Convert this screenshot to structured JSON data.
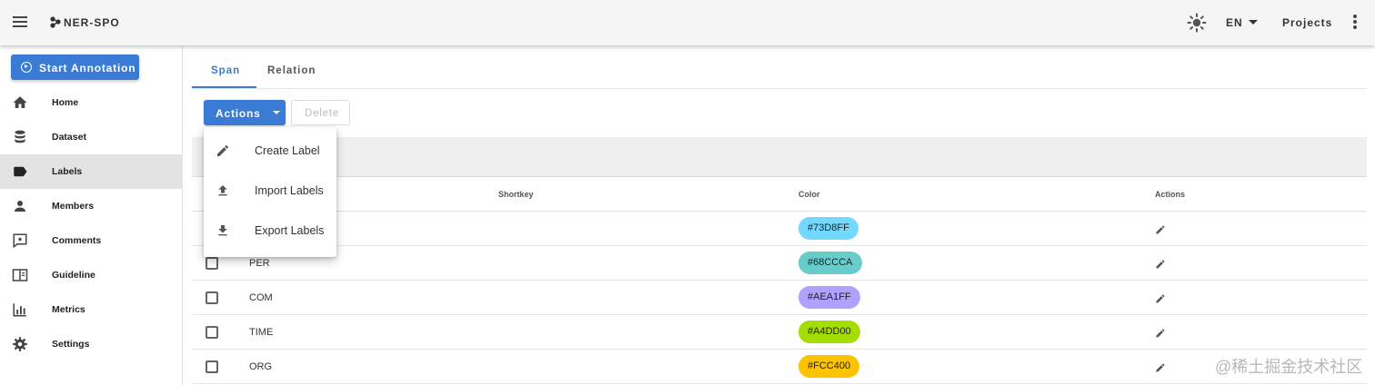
{
  "appbar": {
    "title": "NER-SPO",
    "language": "EN",
    "projects_label": "Projects",
    "icons": [
      "menu-icon",
      "logo-icon",
      "theme-icon",
      "caret-down-icon",
      "more-vert-icon"
    ]
  },
  "sidebar": {
    "start_annotation": "Start Annotation",
    "items": [
      {
        "label": "Home",
        "icon": "home-icon"
      },
      {
        "label": "Dataset",
        "icon": "database-icon"
      },
      {
        "label": "Labels",
        "icon": "label-icon",
        "active": true
      },
      {
        "label": "Members",
        "icon": "person-icon"
      },
      {
        "label": "Comments",
        "icon": "comment-icon"
      },
      {
        "label": "Guideline",
        "icon": "book-icon"
      },
      {
        "label": "Metrics",
        "icon": "chart-icon"
      },
      {
        "label": "Settings",
        "icon": "gear-icon"
      }
    ]
  },
  "tabs": [
    {
      "label": "Span",
      "active": true
    },
    {
      "label": "Relation",
      "active": false
    }
  ],
  "toolbar": {
    "actions_label": "Actions",
    "delete_label": "Delete"
  },
  "actions_menu": [
    {
      "label": "Create Label",
      "icon": "pencil-icon"
    },
    {
      "label": "Import Labels",
      "icon": "upload-icon"
    },
    {
      "label": "Export Labels",
      "icon": "download-icon"
    }
  ],
  "table": {
    "headers": {
      "shortkey": "Shortkey",
      "color": "Color",
      "actions": "Actions"
    },
    "rows": [
      {
        "name": "",
        "color_text": "#73D8FF",
        "color": "#73D8FF"
      },
      {
        "name": "PER",
        "color_text": "#68CCCA",
        "color": "#68CCCA"
      },
      {
        "name": "COM",
        "color_text": "#AEA1FF",
        "color": "#AEA1FF"
      },
      {
        "name": "TIME",
        "color_text": "#A4DD00",
        "color": "#A4DD00"
      },
      {
        "name": "ORG",
        "color_text": "#FCC400",
        "color": "#FCC400"
      }
    ]
  },
  "watermark": "@稀土掘金技术社区",
  "colors": {
    "primary": "#3a7bd5",
    "appbar_bg": "#f5f5f5",
    "active_nav_bg": "#e3e3e3"
  }
}
